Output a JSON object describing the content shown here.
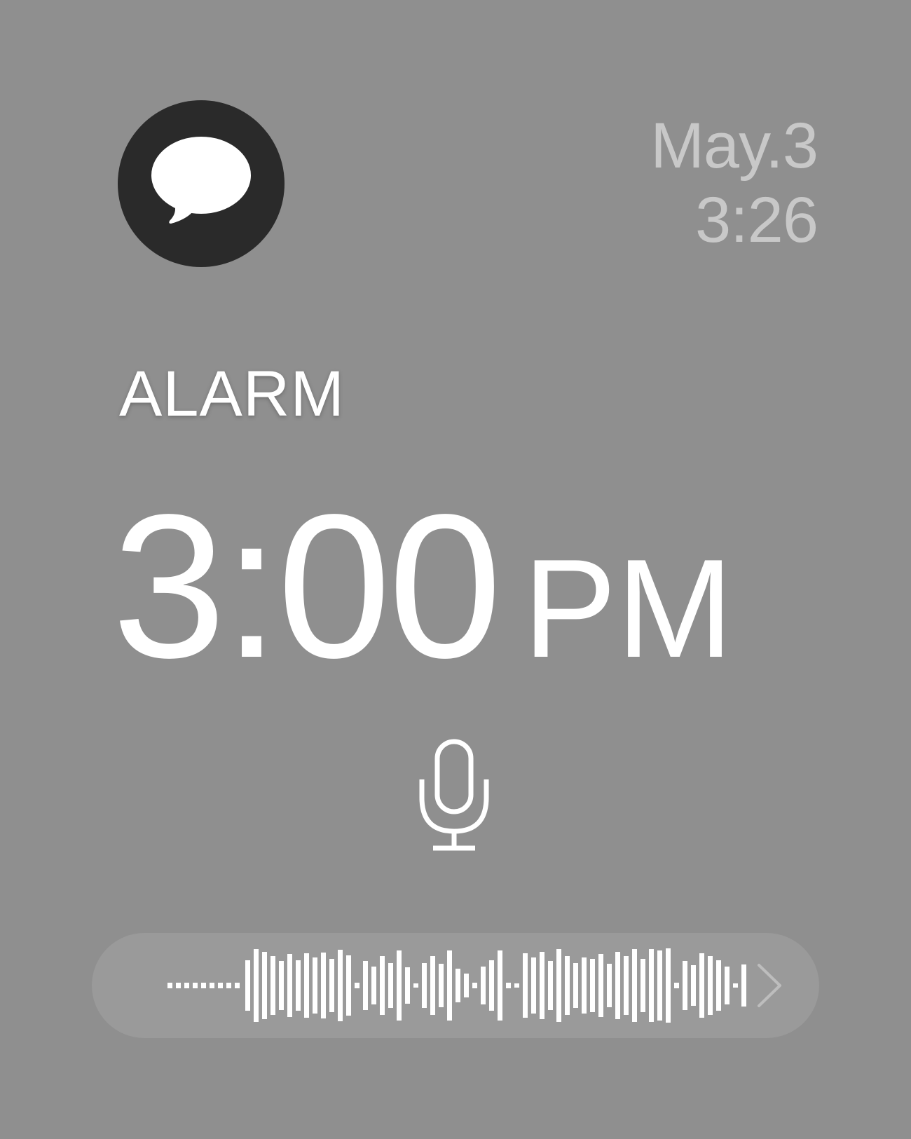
{
  "header": {
    "app_icon": "speech-bubble-icon",
    "date": "May.3",
    "time": "3:26"
  },
  "alarm": {
    "label": "ALARM",
    "time": "3:00",
    "period": "PM"
  },
  "voice_input": {
    "mic_icon": "microphone-icon",
    "waveform_icon": "audio-waveform-icon",
    "next_icon": "chevron-right-icon"
  },
  "colors": {
    "background": "#8f8f8f",
    "icon_circle": "#2a2a2a",
    "primary_text": "#ffffff",
    "secondary_text": "#c8c8c8"
  }
}
